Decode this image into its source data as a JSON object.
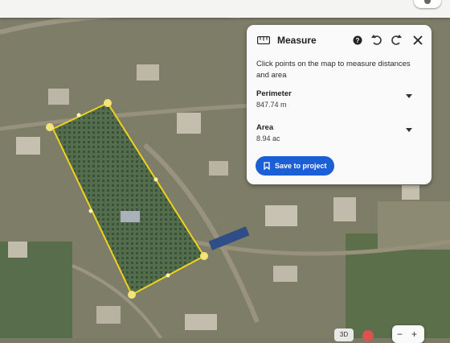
{
  "panel": {
    "title": "Measure",
    "instruction": "Click points on the map to measure distances and area",
    "perimeter": {
      "label": "Perimeter",
      "value": "847.74 m"
    },
    "area": {
      "label": "Area",
      "value": "8.94 ac"
    },
    "save_label": "Save to project",
    "icons": [
      "ruler-icon",
      "help-icon",
      "undo-icon",
      "redo-icon",
      "close-icon",
      "chevron-down-icon",
      "bookmark-icon"
    ]
  },
  "map_controls": {
    "view_3d": "3D",
    "zoom_in": "+",
    "zoom_out": "−"
  },
  "colors": {
    "polygon": "#f1d21d",
    "vertex": "#f4e37a",
    "accent": "#1a5fd6",
    "panel_bg": "#fafafa"
  }
}
